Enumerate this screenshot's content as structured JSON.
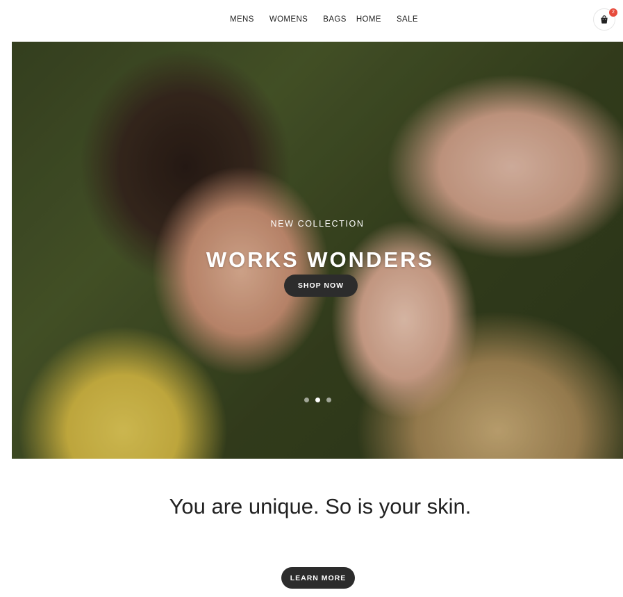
{
  "nav": {
    "items": [
      {
        "label": "MENS"
      },
      {
        "label": "WOMENS"
      },
      {
        "label": "BAGS"
      },
      {
        "label": "HOME"
      },
      {
        "label": "SALE"
      }
    ]
  },
  "cart": {
    "icon": "shopping-bag-icon",
    "count": "2",
    "badge_color": "#e74b3c"
  },
  "hero": {
    "subtitle": "NEW COLLECTION",
    "title": "WORKS WONDERS",
    "button_label": "SHOP NOW",
    "slides": {
      "count": 3,
      "active": 2
    },
    "image": "two women lying on grass, heads together"
  },
  "intro": {
    "tagline": "You are unique. So is your skin.",
    "button_label": "LEARN MORE"
  },
  "colors": {
    "button_bg": "#2c2c2c",
    "text": "#222222"
  }
}
